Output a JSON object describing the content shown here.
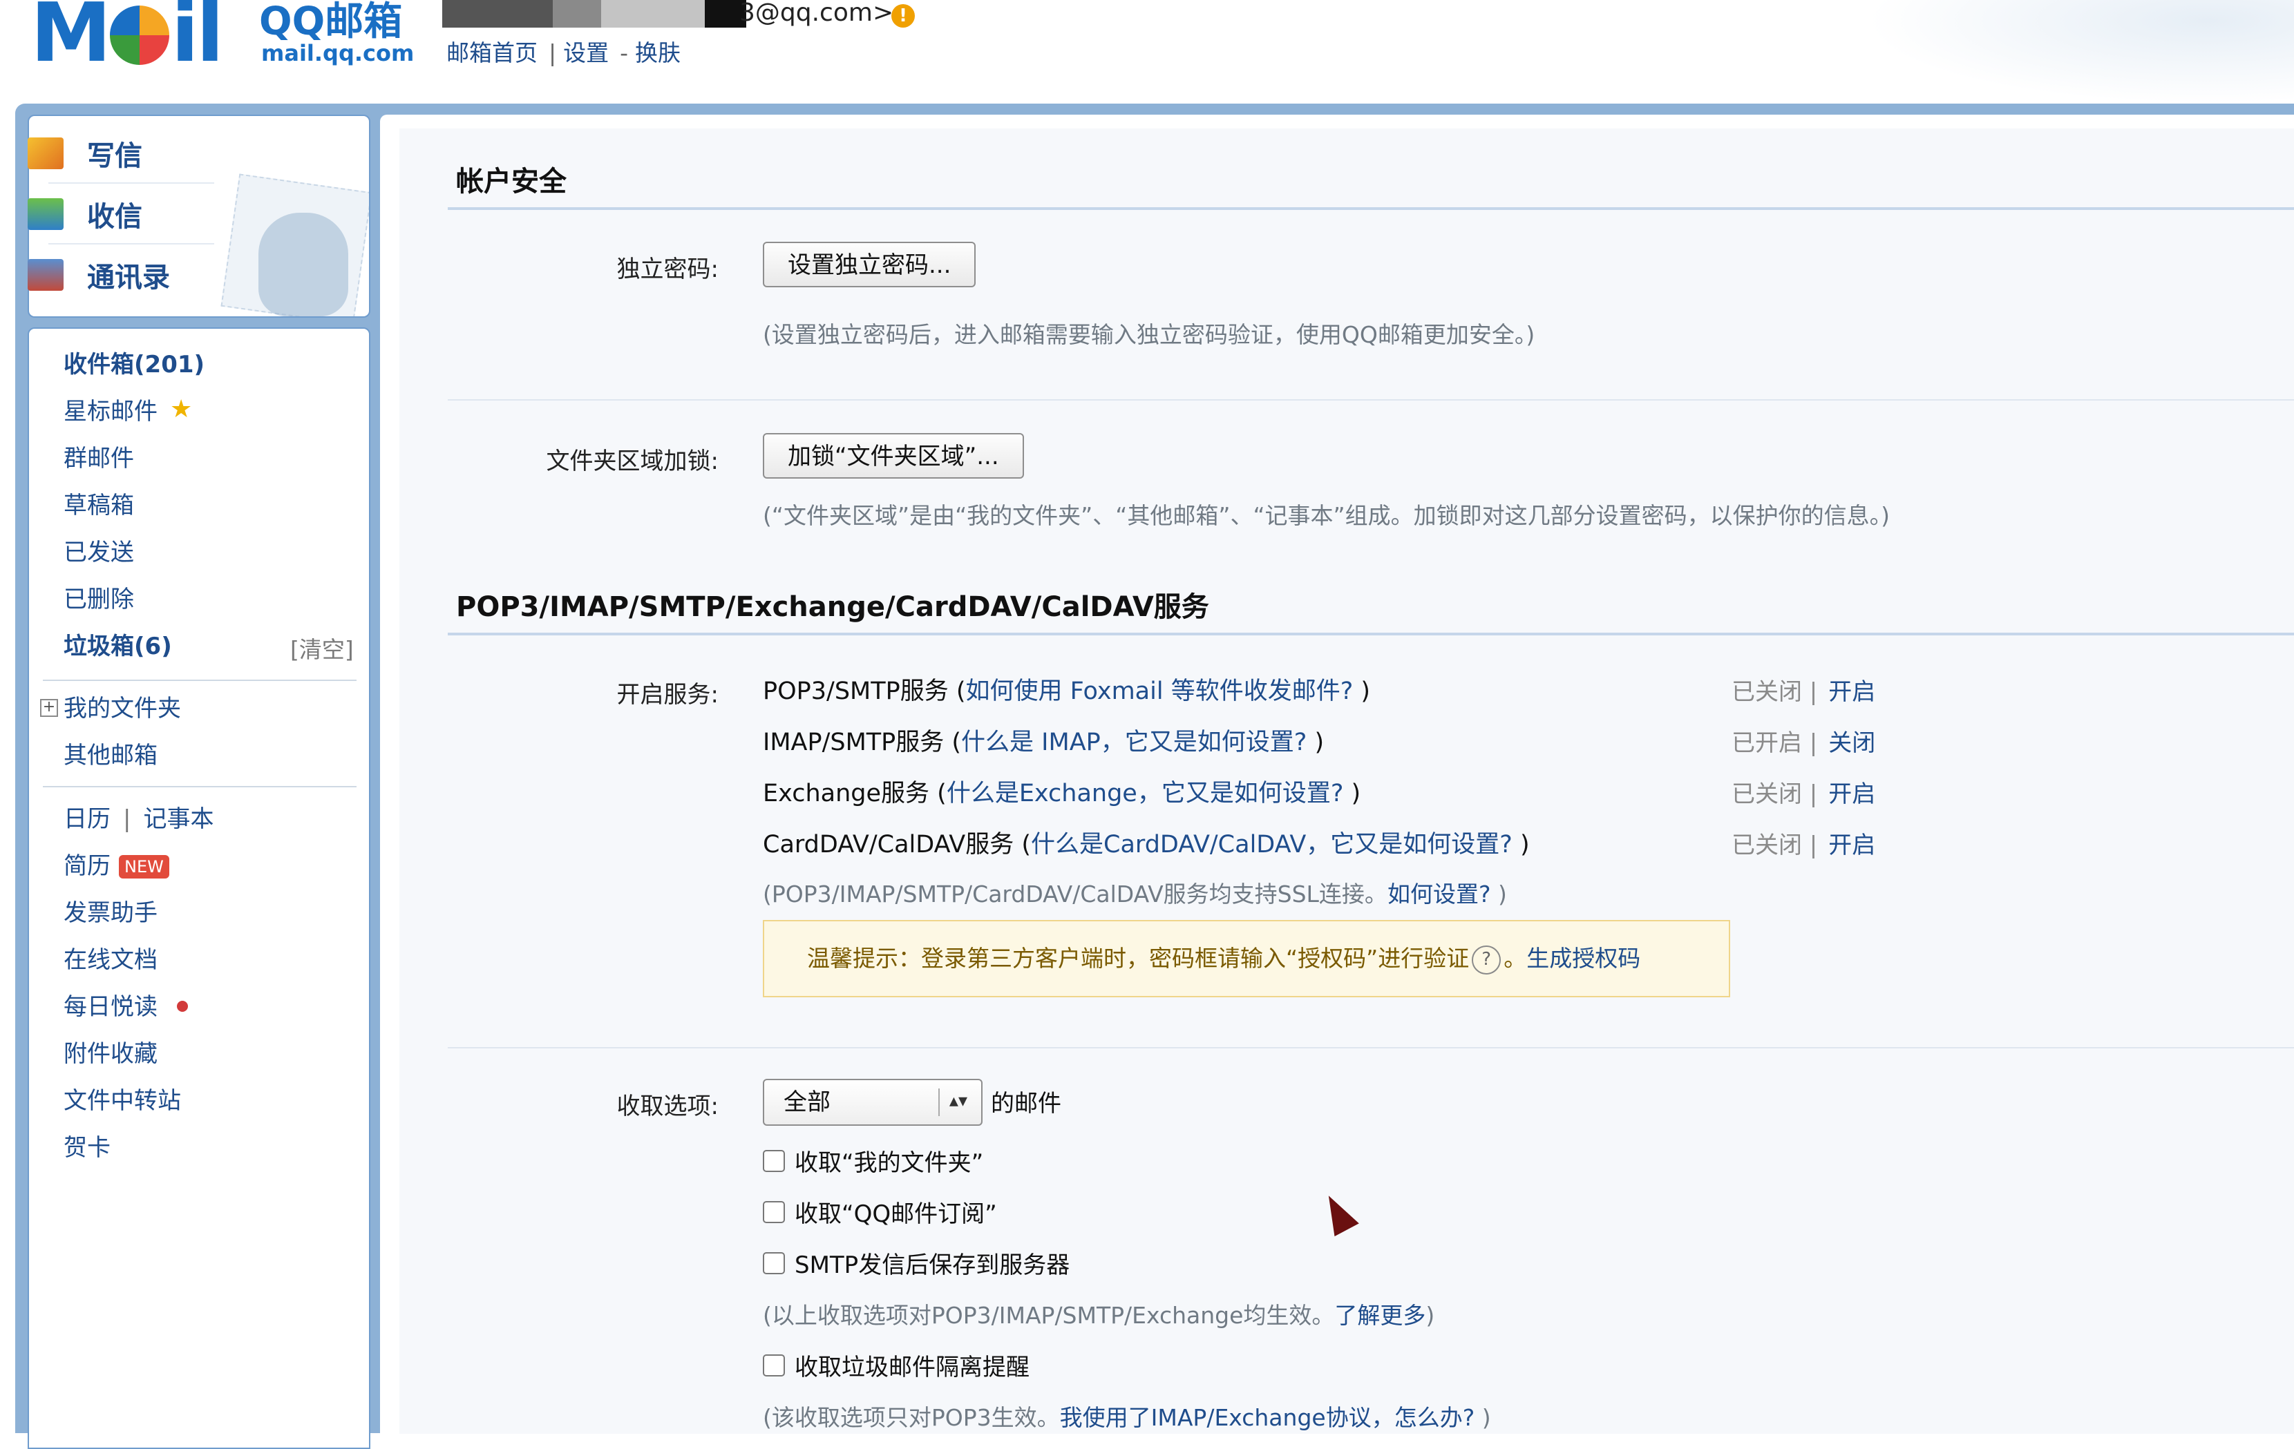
{
  "header": {
    "logo_mark": "M",
    "logo_mark_tail": "il",
    "logo_text": "QQ邮箱",
    "logo_sub": "mail.qq.com",
    "user_email": "3@qq.com>",
    "warning_symbol": "!",
    "links": [
      "邮箱首页",
      "设置",
      "换肤"
    ],
    "link_seps": [
      "|",
      "-"
    ]
  },
  "quick": {
    "write": "写信",
    "receive": "收信",
    "contacts": "通讯录"
  },
  "nav": {
    "inbox": "收件箱(201)",
    "starred": "星标邮件",
    "star_symbol": "★",
    "group": "群邮件",
    "drafts": "草稿箱",
    "sent": "已发送",
    "deleted": "已删除",
    "spam": "垃圾箱(6)",
    "spam_clear": "[清空]",
    "my_folders": "我的文件夹",
    "expand_symbol": "+",
    "other_mailbox": "其他邮箱",
    "calendar": "日历",
    "nav_sep": "|",
    "notebook": "记事本",
    "resume": "简历",
    "new_badge": "NEW",
    "invoice": "发票助手",
    "docs": "在线文档",
    "daily_read": "每日悦读",
    "attachments": "附件收藏",
    "transfer": "文件中转站",
    "cards": "贺卡"
  },
  "security": {
    "title": "帐户安全",
    "pwd_label": "独立密码:",
    "pwd_button": "设置独立密码...",
    "pwd_hint": "(设置独立密码后，进入邮箱需要输入独立密码验证，使用QQ邮箱更加安全。)",
    "lock_label": "文件夹区域加锁:",
    "lock_button": "加锁“文件夹区域”...",
    "lock_hint": "(“文件夹区域”是由“我的文件夹”、“其他邮箱”、“记事本”组成。加锁即对这几部分设置密码，以保护你的信息。)"
  },
  "services": {
    "title": "POP3/IMAP/SMTP/Exchange/CardDAV/CalDAV服务",
    "label": "开启服务:",
    "items": [
      {
        "name": "POP3/SMTP服务 (",
        "link": "如何使用 Foxmail 等软件收发邮件?",
        "close": " )",
        "status": "已关闭 |",
        "action": "开启"
      },
      {
        "name": "IMAP/SMTP服务 (",
        "link": "什么是 IMAP，它又是如何设置?",
        "close": " )",
        "status": "已开启 |",
        "action": "关闭"
      },
      {
        "name": "Exchange服务 (",
        "link": "什么是Exchange，它又是如何设置?",
        "close": " )",
        "status": "已关闭 |",
        "action": "开启"
      },
      {
        "name": "CardDAV/CalDAV服务 (",
        "link": "什么是CardDAV/CalDAV，它又是如何设置?",
        "close": " )",
        "status": "已关闭 |",
        "action": "开启"
      }
    ],
    "ssl_hint": "(POP3/IMAP/SMTP/CardDAV/CalDAV服务均支持SSL连接。",
    "ssl_link": "如何设置?",
    "ssl_close": " )",
    "tip_text": "温馨提示：登录第三方客户端时，密码框请输入“授权码”进行验证",
    "tip_q": "?",
    "tip_sep": "。",
    "tip_link": "生成授权码"
  },
  "fetch": {
    "label": "收取选项:",
    "select_value": "全部",
    "select_arrow": "▴▾",
    "after_select": "的邮件",
    "opt1": "收取“我的文件夹”",
    "opt2": "收取“QQ邮件订阅”",
    "opt3": "SMTP发信后保存到服务器",
    "hint1": "(以上收取选项对POP3/IMAP/SMTP/Exchange均生效。",
    "hint1_link": "了解更多",
    "hint1_close": ")",
    "opt4": "收取垃圾邮件隔离提醒",
    "hint2": "(该收取选项只对POP3生效。",
    "hint2_link": "我使用了IMAP/Exchange协议，怎么办?",
    "hint2_close": " )"
  }
}
